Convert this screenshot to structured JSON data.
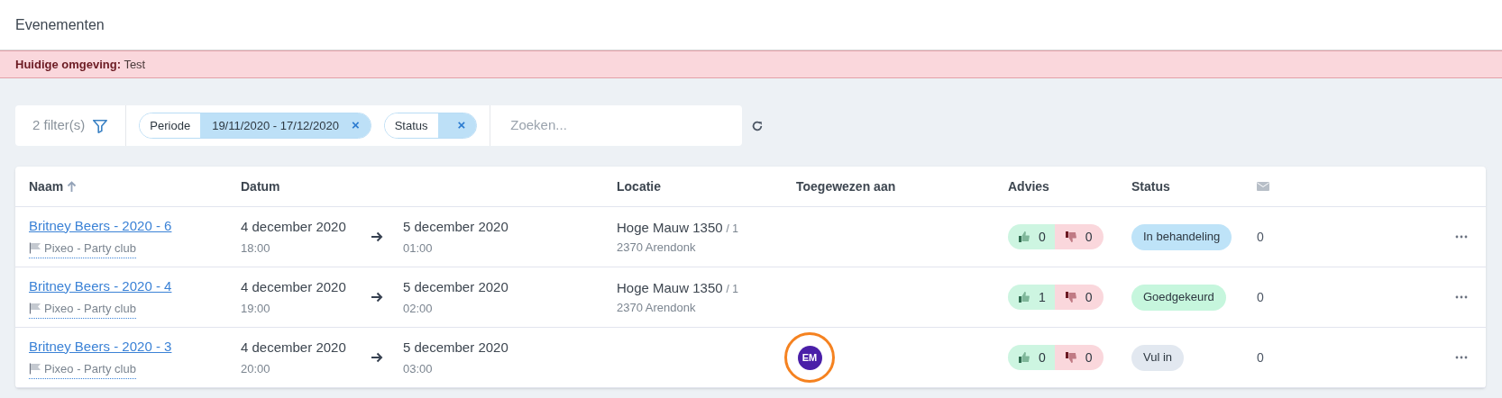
{
  "page_title": "Evenementen",
  "environment_banner": {
    "label": "Huidige omgeving:",
    "value": "Test"
  },
  "filter_bar": {
    "filter_count": "2 filter(s)",
    "chips": [
      {
        "label": "Periode",
        "value": "19/11/2020 - 17/12/2020",
        "remove": "×"
      },
      {
        "label": "Status",
        "remove": "×"
      }
    ],
    "search": {
      "placeholder": "Zoeken..."
    }
  },
  "table": {
    "columns": [
      {
        "label": "Naam",
        "sorted": true
      },
      {
        "label": "Datum",
        "sorted": false
      },
      {
        "label": "Locatie",
        "sorted": false
      },
      {
        "label": "Toegewezen aan",
        "sorted": false
      },
      {
        "label": "Advies",
        "sorted": false
      },
      {
        "label": "Status",
        "sorted": false
      }
    ],
    "rows": [
      {
        "name": "Britney Beers - 2020 - 6",
        "venue": "Pixeo - Party club",
        "start_date": "4 december 2020",
        "start_time": "18:00",
        "end_date": "5 december 2020",
        "end_time": "01:00",
        "address": "Hoge Mauw 1350",
        "unit": "/ 1",
        "city": "2370 Arendonk",
        "assignee": null,
        "likes": "0",
        "dislikes": "0",
        "status": {
          "label": "In behandeling",
          "color": "#bee3f8"
        },
        "messages": "0"
      },
      {
        "name": "Britney Beers - 2020 - 4",
        "venue": "Pixeo - Party club",
        "start_date": "4 december 2020",
        "start_time": "19:00",
        "end_date": "5 december 2020",
        "end_time": "02:00",
        "address": "Hoge Mauw 1350",
        "unit": "/ 1",
        "city": "2370 Arendonk",
        "assignee": null,
        "likes": "1",
        "dislikes": "0",
        "status": {
          "label": "Goedgekeurd",
          "color": "#c6f6dd"
        },
        "messages": "0"
      },
      {
        "name": "Britney Beers - 2020 - 3",
        "venue": "Pixeo - Party club",
        "start_date": "4 december 2020",
        "start_time": "20:00",
        "end_date": "5 december 2020",
        "end_time": "03:00",
        "address": null,
        "unit": null,
        "city": null,
        "assignee": {
          "initials": "EM",
          "highlighted": true
        },
        "likes": "0",
        "dislikes": "0",
        "status": {
          "label": "Vul in",
          "color": "#e2e8f0"
        },
        "messages": "0"
      }
    ]
  }
}
